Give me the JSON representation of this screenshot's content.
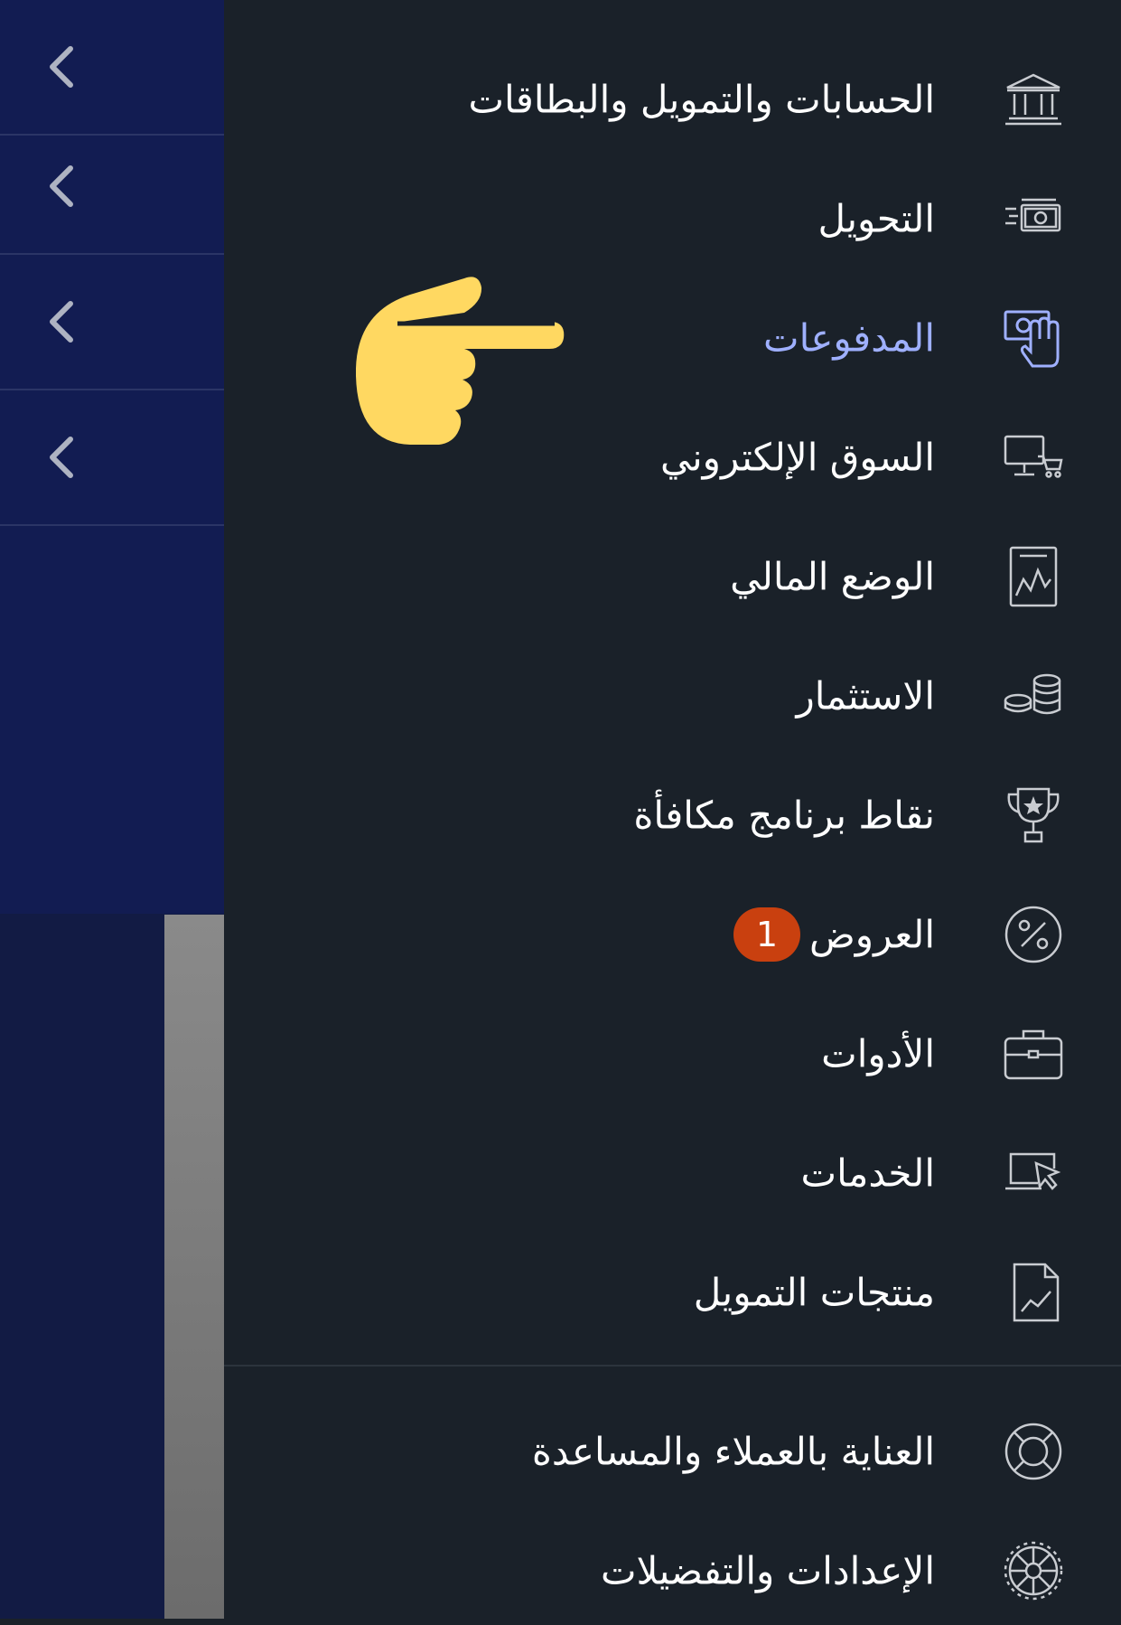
{
  "menu": {
    "items": [
      {
        "label": "الحسابات والتمويل والبطاقات",
        "icon": "bank-icon"
      },
      {
        "label": "التحويل",
        "icon": "money-transfer-icon"
      },
      {
        "label": "المدفوعات",
        "icon": "payment-hand-icon",
        "active": true
      },
      {
        "label": "السوق الإلكتروني",
        "icon": "monitor-cart-icon"
      },
      {
        "label": "الوضع المالي",
        "icon": "financial-chart-icon"
      },
      {
        "label": "الاستثمار",
        "icon": "coins-stack-icon"
      },
      {
        "label": "نقاط برنامج مكافأة",
        "icon": "trophy-icon"
      },
      {
        "label": "العروض",
        "icon": "percent-icon",
        "badge": "1"
      },
      {
        "label": "الأدوات",
        "icon": "briefcase-icon"
      },
      {
        "label": "الخدمات",
        "icon": "laptop-cursor-icon"
      },
      {
        "label": "منتجات التمويل",
        "icon": "document-chart-icon"
      },
      {
        "label": "العناية بالعملاء والمساعدة",
        "icon": "lifebuoy-icon"
      },
      {
        "label": "الإعدادات والتفضيلات",
        "icon": "settings-wheel-icon"
      }
    ]
  },
  "left_panel": {
    "chevrons": 4
  },
  "colors": {
    "background": "#1a2129",
    "left_panel": "#121c52",
    "active_label": "#9fb0ff",
    "badge": "#c9400f",
    "pointer_hand": "#ffd861",
    "icon_stroke": "#c9ccd1"
  }
}
